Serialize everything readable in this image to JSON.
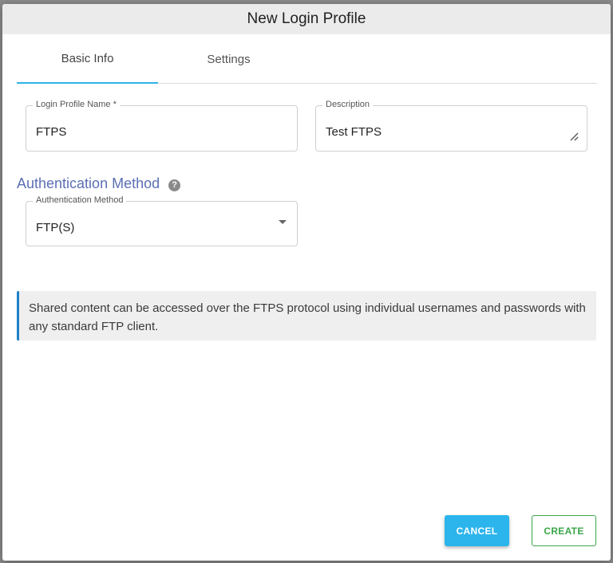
{
  "dialog": {
    "title": "New Login Profile"
  },
  "tabs": [
    {
      "label": "Basic Info",
      "active": true
    },
    {
      "label": "Settings",
      "active": false
    }
  ],
  "form": {
    "login_profile_name": {
      "label": "Login Profile Name *",
      "value": "FTPS"
    },
    "description": {
      "label": "Description",
      "value": "Test FTPS"
    },
    "auth_section_title": "Authentication Method",
    "auth_method": {
      "label": "Authentication Method",
      "value": "FTP(S)"
    }
  },
  "info": {
    "text": "Shared content can be accessed over the FTPS protocol using individual usernames and passwords with any standard FTP client."
  },
  "buttons": {
    "cancel": "CANCEL",
    "create": "CREATE"
  },
  "icons": {
    "help": "help-icon",
    "dropdown": "chevron-down-icon",
    "resize": "resize-handle-icon"
  },
  "colors": {
    "accent": "#2bb5ec",
    "section_title": "#5b6fb4",
    "create_green": "#3aa64a",
    "info_border": "#1d82c8"
  }
}
